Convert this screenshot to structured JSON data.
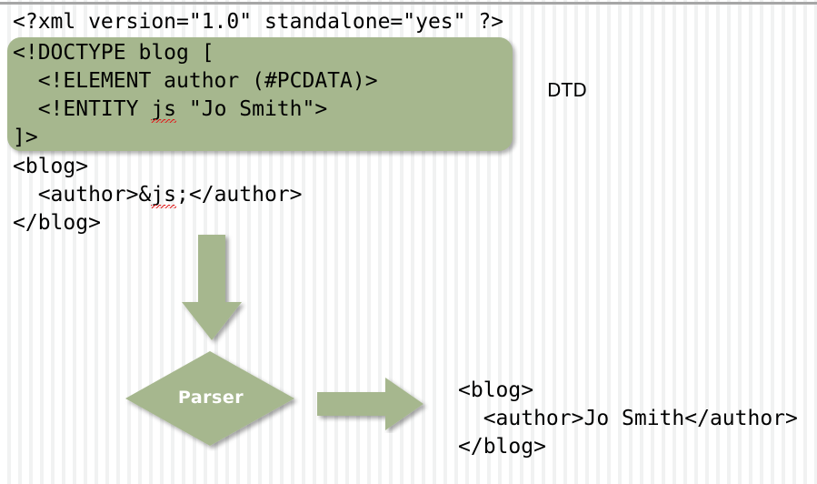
{
  "slide": {
    "title": "XML DTD entity parsing diagram",
    "background_stripe_color": "#f1f2f2",
    "accent_green": "#a6b78e",
    "top_rule_color": "#a6a6a6"
  },
  "xml_declaration": "<?xml version=\"1.0\" standalone=\"yes\" ?>",
  "dtd_block": {
    "caption": "DTD",
    "lines": [
      "<!DOCTYPE blog [",
      "  <!ELEMENT author (#PCDATA)>",
      "  <!ENTITY js \"Jo Smith\">",
      "]>"
    ],
    "entity_line": {
      "prefix": "  <!ENTITY ",
      "misspelled_word": "js",
      "suffix": " \"Jo Smith\">"
    },
    "fill_color": "#a6b78e"
  },
  "xml_body": {
    "line1": "<blog>",
    "line2_prefix": "  <author>&",
    "line2_misspelled": "js",
    "line2_suffix": ";</author>",
    "line3": "</blog>"
  },
  "arrow_down": {
    "label": "down-arrow",
    "color": "#a6b78e"
  },
  "parser": {
    "label": "Parser",
    "shape": "diamond",
    "fill_color": "#a6b78e",
    "text_color": "#ffffff"
  },
  "arrow_right": {
    "label": "right-arrow",
    "color": "#a6b78e"
  },
  "xml_output": {
    "lines": [
      "<blog>",
      "  <author>Jo Smith</author>",
      "</blog>"
    ]
  }
}
